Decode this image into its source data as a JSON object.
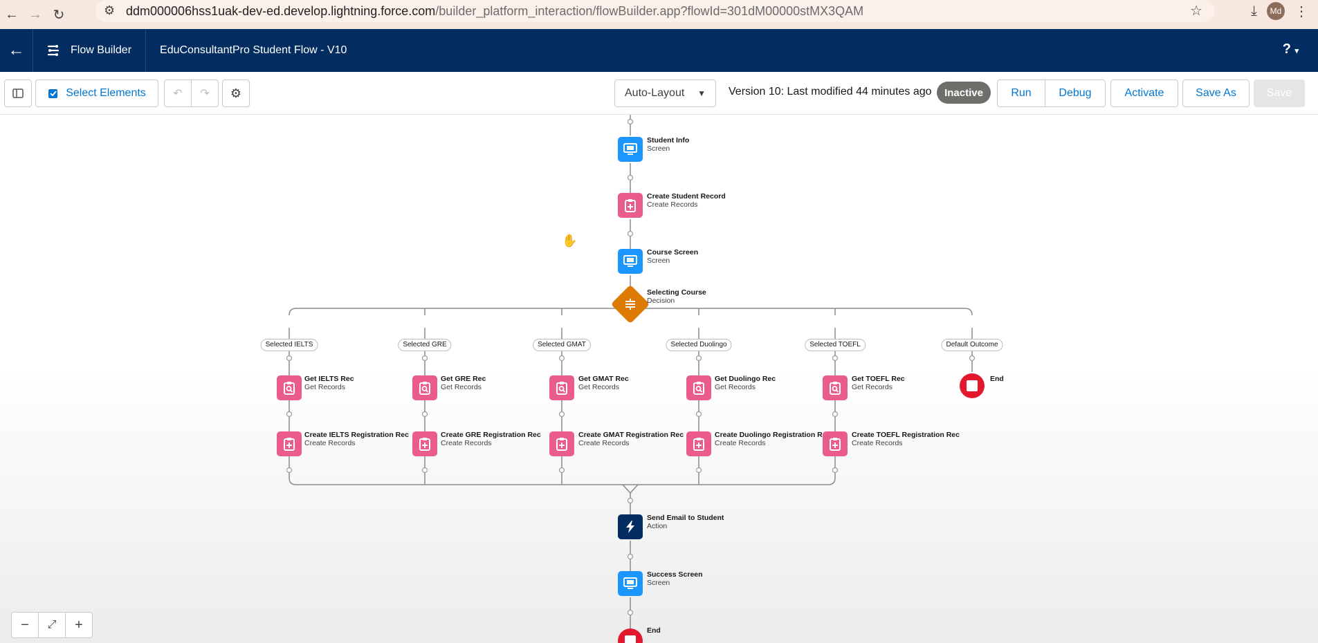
{
  "browser": {
    "url_host": "ddm000006hss1uak-dev-ed.develop.lightning.force.com",
    "url_path": "/builder_platform_interaction/flowBuilder.app?flowId=301dM00000stMX3QAM",
    "avatar": "Md"
  },
  "header": {
    "app_name": "Flow Builder",
    "flow_title": "EduConsultantPro Student Flow - V10",
    "help": "?"
  },
  "toolbar": {
    "select_elements": "Select Elements",
    "layout": "Auto-Layout",
    "version_text": "Version 10: Last modified 44 minutes ago",
    "status_badge": "Inactive",
    "run": "Run",
    "debug": "Debug",
    "activate": "Activate",
    "save_as": "Save As",
    "save": "Save"
  },
  "flow": {
    "student_info": {
      "name": "Student Info",
      "type": "Screen"
    },
    "create_student": {
      "name": "Create Student Record",
      "type": "Create Records"
    },
    "course_screen": {
      "name": "Course Screen",
      "type": "Screen"
    },
    "decision": {
      "name": "Selecting Course",
      "type": "Decision"
    },
    "branches": [
      {
        "outcome": "Selected IELTS",
        "get": "Get IELTS Rec",
        "get_type": "Get Records",
        "create": "Create IELTS Registration Rec",
        "create_type": "Create Records"
      },
      {
        "outcome": "Selected GRE",
        "get": "Get GRE Rec",
        "get_type": "Get Records",
        "create": "Create GRE Registration Rec",
        "create_type": "Create Records"
      },
      {
        "outcome": "Selected GMAT",
        "get": "Get GMAT Rec",
        "get_type": "Get Records",
        "create": "Create GMAT Registration Rec",
        "create_type": "Create Records"
      },
      {
        "outcome": "Selected Duolingo",
        "get": "Get Duolingo Rec",
        "get_type": "Get Records",
        "create": "Create Duolingo Registration Rec",
        "create_type": "Create Records"
      },
      {
        "outcome": "Selected TOEFL",
        "get": "Get TOEFL Rec",
        "get_type": "Get Records",
        "create": "Create TOEFL Registration Rec",
        "create_type": "Create Records"
      }
    ],
    "default_outcome": "Default Outcome",
    "default_end": "End",
    "send_email": {
      "name": "Send Email to Student",
      "type": "Action"
    },
    "success_screen": {
      "name": "Success Screen",
      "type": "Screen"
    },
    "final_end": "End"
  },
  "zoom": {
    "out": "−",
    "fit": "⤢",
    "in": "+"
  },
  "colors": {
    "header": "#032d60",
    "screen": "#1b96ff",
    "records": "#ea5c8a",
    "decision": "#dd7a01",
    "end": "#e3182d"
  }
}
